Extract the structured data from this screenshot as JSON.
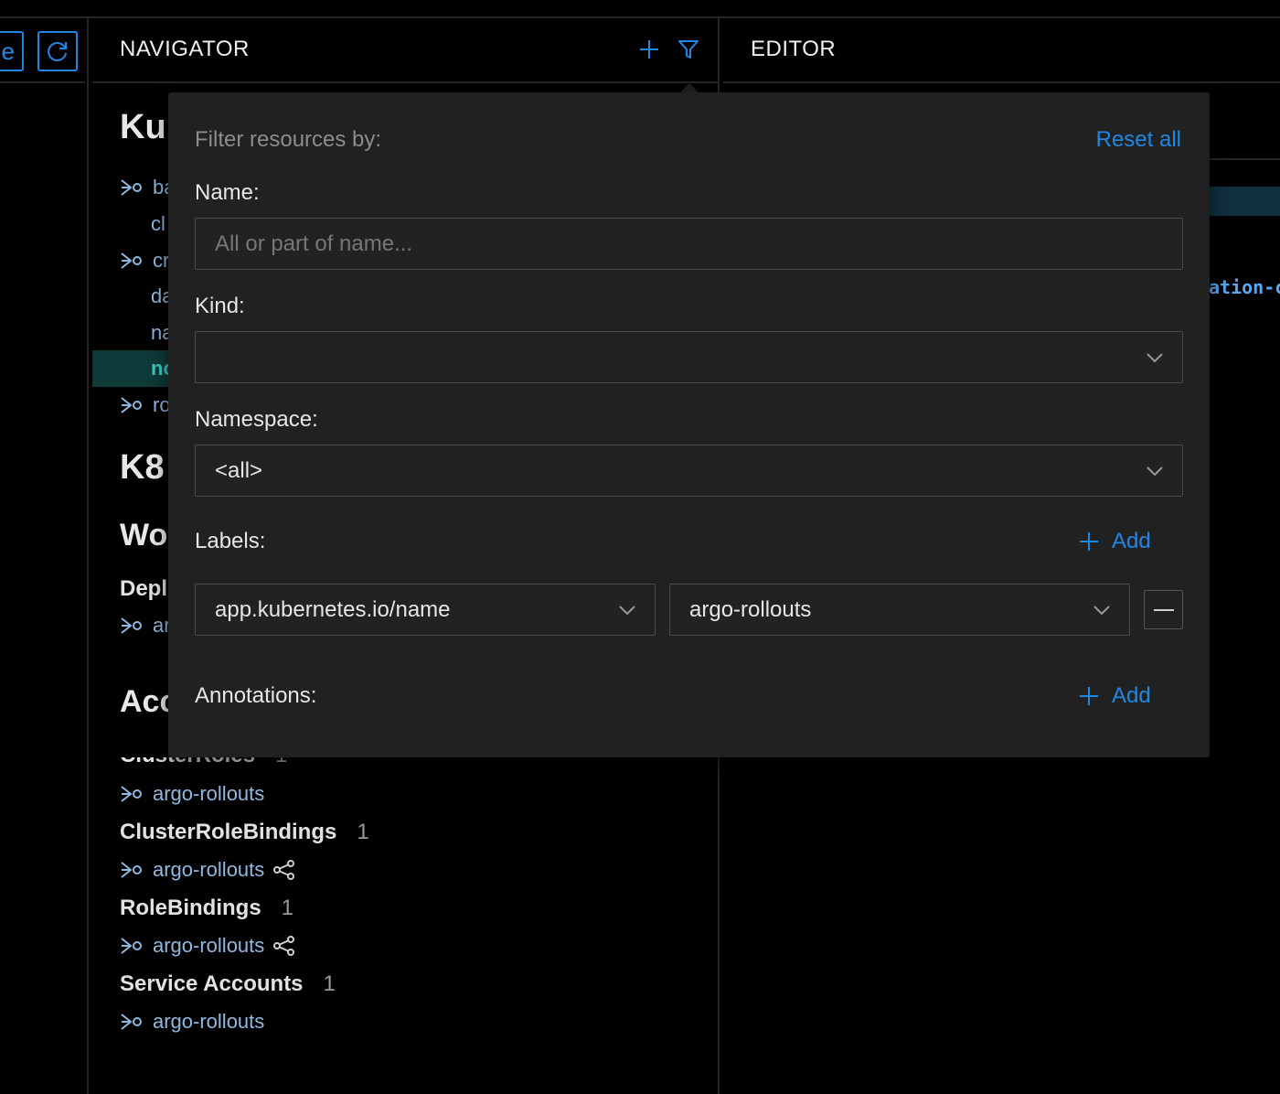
{
  "toolbar": {
    "left_btn_text": "e",
    "refresh_icon": "refresh-icon"
  },
  "navigator": {
    "title": "NAVIGATOR",
    "add_icon": "plus-icon",
    "filter_icon": "filter-icon",
    "sections": {
      "kustomize_partial": "Ku",
      "k8s_partial": "K8",
      "workloads_partial": "Wo",
      "deployments_partial": "Depl",
      "access_partial": "Acc"
    },
    "kustomize_items": [
      {
        "text": "ba",
        "has_icon": true
      },
      {
        "text": "cl",
        "has_icon": false
      },
      {
        "text": "cr",
        "has_icon": true
      },
      {
        "text": "da",
        "has_icon": false
      },
      {
        "text": "na",
        "has_icon": false
      },
      {
        "text": "nc",
        "has_icon": false,
        "selected": true
      },
      {
        "text": "ro",
        "has_icon": true
      }
    ],
    "deployment_item_partial": "ar",
    "groups": [
      {
        "title": "ClusterRoles",
        "count": "1",
        "items": [
          {
            "name": "argo-rollouts",
            "related": false
          }
        ]
      },
      {
        "title": "ClusterRoleBindings",
        "count": "1",
        "items": [
          {
            "name": "argo-rollouts",
            "related": true
          }
        ]
      },
      {
        "title": "RoleBindings",
        "count": "1",
        "items": [
          {
            "name": "argo-rollouts",
            "related": true
          }
        ]
      },
      {
        "title": "Service Accounts",
        "count": "1",
        "items": [
          {
            "name": "argo-rollouts",
            "related": false
          }
        ]
      }
    ],
    "clusterroles_title_visible": "ClusterRoles"
  },
  "editor": {
    "title": "EDITOR",
    "code_fragment": "ation-c"
  },
  "filter": {
    "heading": "Filter resources by:",
    "reset_label": "Reset all",
    "name_label": "Name:",
    "name_placeholder": "All or part of name...",
    "name_value": "",
    "kind_label": "Kind:",
    "kind_value": "",
    "namespace_label": "Namespace:",
    "namespace_value": "<all>",
    "labels_label": "Labels:",
    "labels_add": "Add",
    "label_key": "app.kubernetes.io/name",
    "label_value": "argo-rollouts",
    "annotations_label": "Annotations:",
    "annotations_add": "Add"
  },
  "colors": {
    "accent": "#1e88e5",
    "selected_bg": "#0f3a3a",
    "selected_text": "#3fc8c0",
    "link_text": "#8fb8e0"
  }
}
